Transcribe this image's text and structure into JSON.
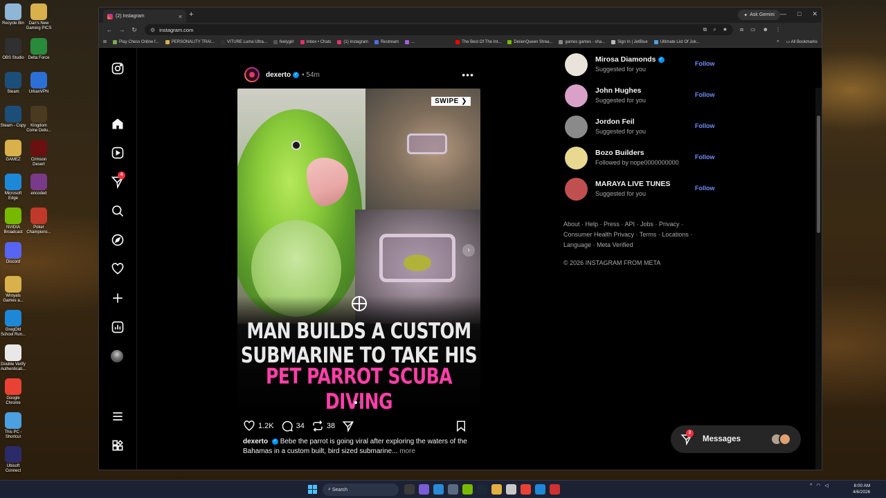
{
  "desktop": {
    "icons": [
      {
        "label": "Recycle Bin",
        "color": "#8fb6d6"
      },
      {
        "label": "Dan's New Gaming PICS",
        "color": "#d8b14c"
      },
      {
        "label": "OBS Studio",
        "color": "#303030"
      },
      {
        "label": "Delta Force",
        "color": "#2a8a3c"
      },
      {
        "label": "Steam",
        "color": "#1b4f7a"
      },
      {
        "label": "UrbanVPN",
        "color": "#2c6fd6"
      },
      {
        "label": "Steam - Copy",
        "color": "#1b4f7a"
      },
      {
        "label": "Kingdom Come Deliv...",
        "color": "#4a3a20"
      },
      {
        "label": "GAMEZ",
        "color": "#d8b14c"
      },
      {
        "label": "Crimson Desert",
        "color": "#6a1010"
      },
      {
        "label": "Microsoft Edge",
        "color": "#1e88d8"
      },
      {
        "label": "encoded",
        "color": "#7a3a8a"
      },
      {
        "label": "NVIDIA Broadcast",
        "color": "#76b900"
      },
      {
        "label": "Poker Champions...",
        "color": "#c0392b"
      },
      {
        "label": "Discord",
        "color": "#5865f2"
      },
      {
        "label": "Wroyals Games a...",
        "color": "#d8b14c"
      },
      {
        "label": "GregOld School Run...",
        "color": "#1e88d8"
      },
      {
        "label": "Double Verify Authenticati...",
        "color": "#e8e8e8"
      },
      {
        "label": "Google Chrome",
        "color": "#e94235"
      },
      {
        "label": "This PC - Shortcut",
        "color": "#4aa0e0"
      },
      {
        "label": "Ubisoft Connect",
        "color": "#2b2b6a"
      }
    ]
  },
  "browser": {
    "tab_title": "(2) Instagram",
    "new_tab": "+",
    "ask_gemini": "Ask Gemini",
    "url": "instagram.com",
    "bookmarks": [
      {
        "label": "Play Chess Online f...",
        "color": "#7fa650"
      },
      {
        "label": "PERSONALITY TRAI...",
        "color": "#d8b14c"
      },
      {
        "label": "VITURE Luma Ultra...",
        "color": "#333"
      },
      {
        "label": "feelygirl",
        "color": "#555"
      },
      {
        "label": "Inbox • Chats",
        "color": "#e1306c"
      },
      {
        "label": "(1) Instagram",
        "color": "#e1306c"
      },
      {
        "label": "Restream",
        "color": "#4a6cf7"
      },
      {
        "label": "...",
        "color": "#a060e0"
      },
      {
        "label": "The Best Of The Int...",
        "color": "#ff0000"
      },
      {
        "label": "DeiienQueen Strea...",
        "color": "#76b900"
      },
      {
        "label": "games games - sha...",
        "color": "#888"
      },
      {
        "label": "Sign In | JetBlue",
        "color": "#bbb"
      },
      {
        "label": "Ultimate List Of Jok...",
        "color": "#4aa0e0"
      }
    ],
    "all_bookmarks": "All Bookmarks"
  },
  "nav": {
    "notifications_badge": "4"
  },
  "post": {
    "username": "dexerto",
    "verified": "✓",
    "time": "54m",
    "more": "•••",
    "swipe_label": "SWIPE ❯",
    "headline_line1": "MAN BUILDS A CUSTOM",
    "headline_line2": "SUBMARINE TO TAKE HIS",
    "headline_line3": "PET PARROT SCUBA DIVING",
    "likes": "1.2K",
    "comments": "34",
    "reposts": "38",
    "caption_user": "dexerto",
    "caption_text": "Bebe the parrot is going viral after exploring the waters of the Bahamas in a custom built, bird sized submarine...",
    "caption_more": "more"
  },
  "suggestions": [
    {
      "name": "Mirosa Diamonds",
      "verified": true,
      "sub": "Suggested for you",
      "follow": "Follow",
      "avatar_color": "#e8e4dc"
    },
    {
      "name": "John Hughes",
      "verified": false,
      "sub": "Suggested for you",
      "follow": "Follow",
      "avatar_color": "#d9a0c8"
    },
    {
      "name": "Jordon Feil",
      "verified": false,
      "sub": "Suggested for you",
      "follow": "Follow",
      "avatar_color": "#8a8a8a"
    },
    {
      "name": "Bozo Builders",
      "verified": false,
      "sub": "Followed by nope0000000000",
      "follow": "Follow",
      "avatar_color": "#e8d890"
    },
    {
      "name": "MARAYA LIVE TUNES",
      "verified": false,
      "sub": "Suggested for you",
      "follow": "Follow",
      "avatar_color": "#c05050"
    }
  ],
  "footer": {
    "links": "About · Help · Press · API · Jobs · Privacy · Consumer Health Privacy · Terms · Locations · Language · Meta Verified",
    "copyright": "© 2026 INSTAGRAM FROM META"
  },
  "messages": {
    "label": "Messages",
    "badge": "2"
  },
  "taskbar": {
    "search": "Search",
    "time": "8:00 AM",
    "date": "4/6/2026"
  }
}
